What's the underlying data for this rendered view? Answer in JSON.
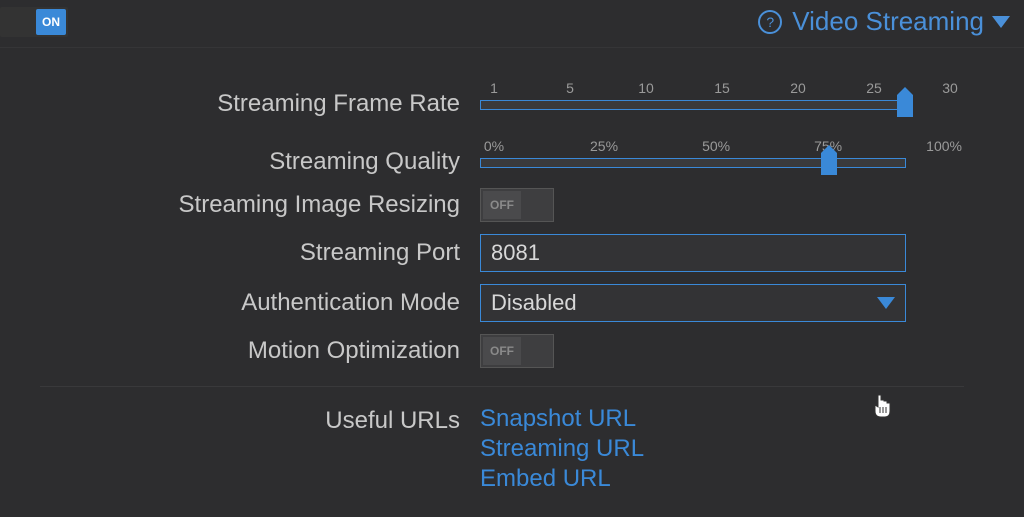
{
  "header": {
    "main_toggle_label": "ON",
    "panel_title": "Video Streaming"
  },
  "frameRate": {
    "label": "Streaming Frame Rate",
    "ticks": [
      "1",
      "5",
      "10",
      "15",
      "20",
      "25",
      "30"
    ],
    "value_percent": 100
  },
  "quality": {
    "label": "Streaming Quality",
    "ticks": [
      "0%",
      "25%",
      "50%",
      "75%",
      "100%"
    ],
    "value_percent": 82
  },
  "imageResizing": {
    "label": "Streaming Image Resizing",
    "state": "OFF"
  },
  "port": {
    "label": "Streaming Port",
    "value": "8081"
  },
  "authMode": {
    "label": "Authentication Mode",
    "value": "Disabled"
  },
  "motionOpt": {
    "label": "Motion Optimization",
    "state": "OFF"
  },
  "urls": {
    "label": "Useful URLs",
    "links": [
      "Snapshot URL",
      "Streaming URL",
      "Embed URL"
    ]
  }
}
